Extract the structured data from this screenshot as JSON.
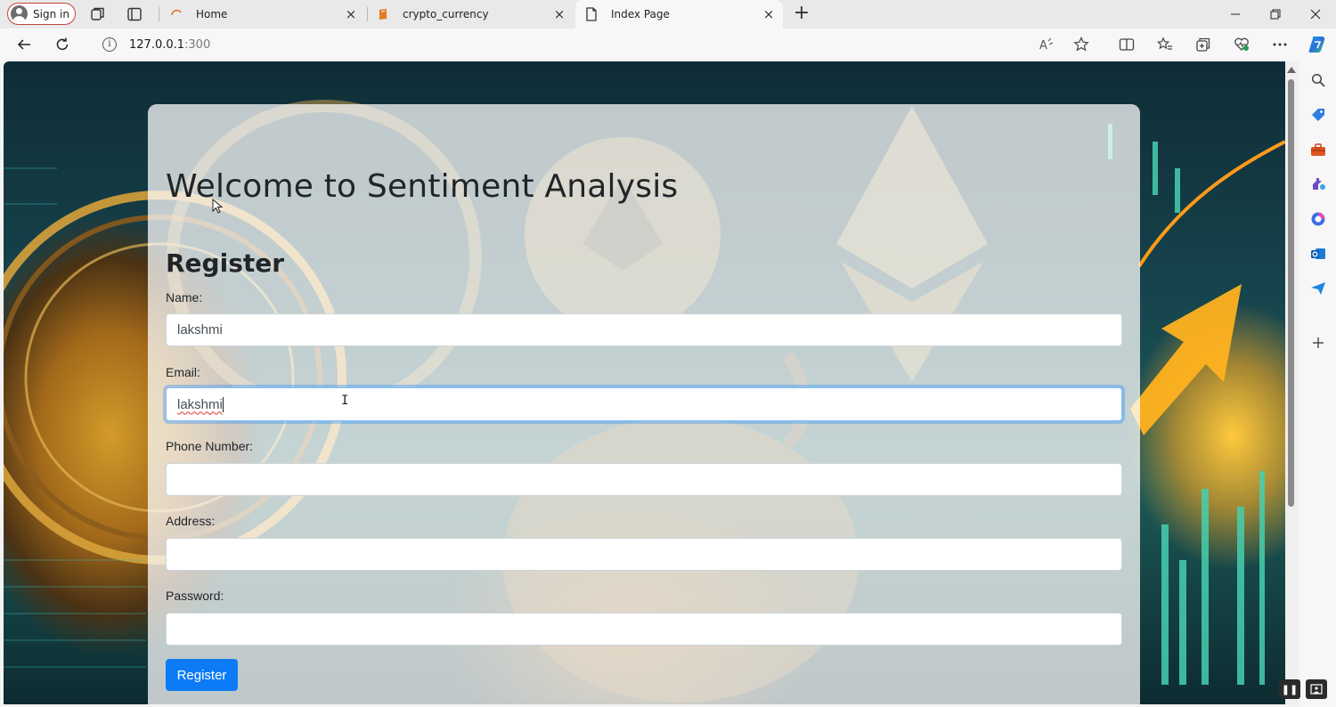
{
  "browser": {
    "signin_label": "Sign in",
    "tabs": [
      {
        "title": "Home"
      },
      {
        "title": "crypto_currency"
      },
      {
        "title": "Index Page"
      }
    ],
    "url_host": "127.0.0.1",
    "url_port": ":300"
  },
  "page": {
    "heading": "Welcome to Sentiment Analysis",
    "form_title": "Register",
    "fields": [
      {
        "label": "Name:",
        "value": "lakshmi"
      },
      {
        "label": "Email:",
        "value": "lakshmi"
      },
      {
        "label": "Phone Number:",
        "value": ""
      },
      {
        "label": "Address:",
        "value": ""
      },
      {
        "label": "Password:",
        "value": ""
      }
    ],
    "submit_label": "Register"
  },
  "colors": {
    "accent": "#0d7bf6",
    "signin_border": "#c3443c"
  }
}
